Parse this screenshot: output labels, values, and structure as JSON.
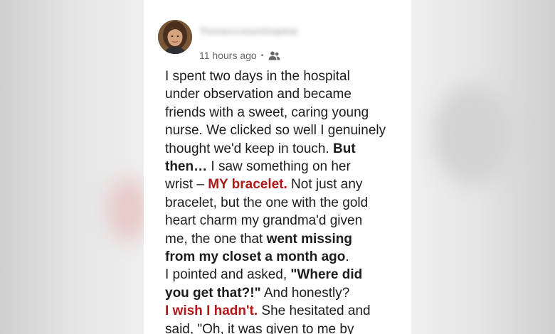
{
  "post": {
    "author_name": "Yoneccountname",
    "time": "11 hours ago",
    "separator": "•",
    "audience_icon": "friends-icon",
    "lines": [
      [
        {
          "t": "I spent two days in the hospital",
          "s": "n"
        }
      ],
      [
        {
          "t": "under observation and became",
          "s": "n"
        }
      ],
      [
        {
          "t": "friends with a sweet, caring young",
          "s": "n"
        }
      ],
      [
        {
          "t": "nurse. We clicked so well I genuinely",
          "s": "n"
        }
      ],
      [
        {
          "t": "thought we'd keep in touch. ",
          "s": "n"
        },
        {
          "t": "But",
          "s": "b"
        }
      ],
      [
        {
          "t": "then…",
          "s": "b"
        },
        {
          "t": " I saw something on her",
          "s": "n"
        }
      ],
      [
        {
          "t": "wrist – ",
          "s": "n"
        },
        {
          "t": "MY bracelet.",
          "s": "r"
        },
        {
          "t": " Not just any",
          "s": "n"
        }
      ],
      [
        {
          "t": "bracelet, but the one with the gold",
          "s": "n"
        }
      ],
      [
        {
          "t": "heart charm my grandma'd given",
          "s": "n"
        }
      ],
      [
        {
          "t": "me, the one that ",
          "s": "n"
        },
        {
          "t": "went missing",
          "s": "b"
        }
      ],
      [
        {
          "t": "from my closet a month ago",
          "s": "b"
        },
        {
          "t": ".",
          "s": "n"
        }
      ],
      [
        {
          "t": "I pointed and asked, ",
          "s": "n"
        },
        {
          "t": "\"Where did",
          "s": "b"
        }
      ],
      [
        {
          "t": "you get that?!\"",
          "s": "b"
        },
        {
          "t": " And honestly?",
          "s": "n"
        }
      ],
      [
        {
          "t": "I wish I hadn't.",
          "s": "r"
        },
        {
          "t": " She hesitated and",
          "s": "n"
        }
      ],
      [
        {
          "t": "said, \"Oh, it was given to me by",
          "s": "n"
        }
      ]
    ]
  },
  "colors": {
    "accent_red": "#b01818",
    "text": "#1c1c1c",
    "meta": "#65676b"
  }
}
